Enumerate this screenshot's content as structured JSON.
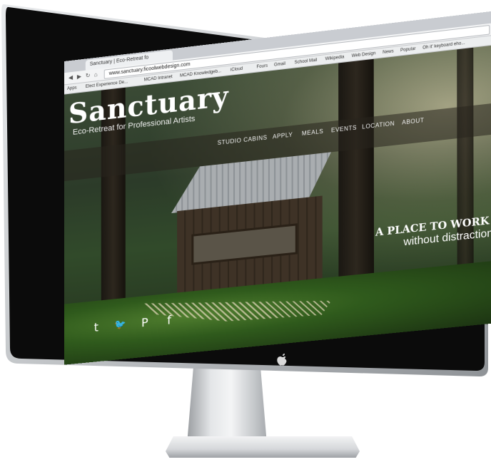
{
  "browser": {
    "tab_title": "Sanctuary | Eco-Retreat fo",
    "url": "www.sanctuary.ficoolwebdesign.com",
    "bookmarks": [
      "Apps",
      "Elect Experience De...",
      "MCAD Intranet",
      "MCAD Knowledgeb...",
      "iCloud",
      "Fours",
      "Gmail",
      "School Mail",
      "Wikipedia",
      "Web Design",
      "News",
      "Popular",
      "Oh it' keyboard eho..."
    ]
  },
  "site": {
    "logo": "Sanctuary",
    "tagline": "Eco-Retreat for Professional Artists",
    "nav": [
      "STUDIO CABINS",
      "APPLY",
      "MEALS",
      "EVENTS",
      "LOCATION",
      "ABOUT"
    ],
    "hero_line1": "A PLACE TO WORK",
    "hero_line2": "without distraction",
    "social": [
      {
        "name": "tumblr-icon",
        "glyph": "t"
      },
      {
        "name": "twitter-icon",
        "glyph": "🐦"
      },
      {
        "name": "pinterest-icon",
        "glyph": "P"
      },
      {
        "name": "facebook-icon",
        "glyph": "f"
      }
    ]
  },
  "monitor": {
    "brand_logo": "apple-logo-icon"
  },
  "colors": {
    "bezel": "#0b0b0b",
    "frame": "#c8cbce",
    "text_on_photo": "#ffffff"
  }
}
